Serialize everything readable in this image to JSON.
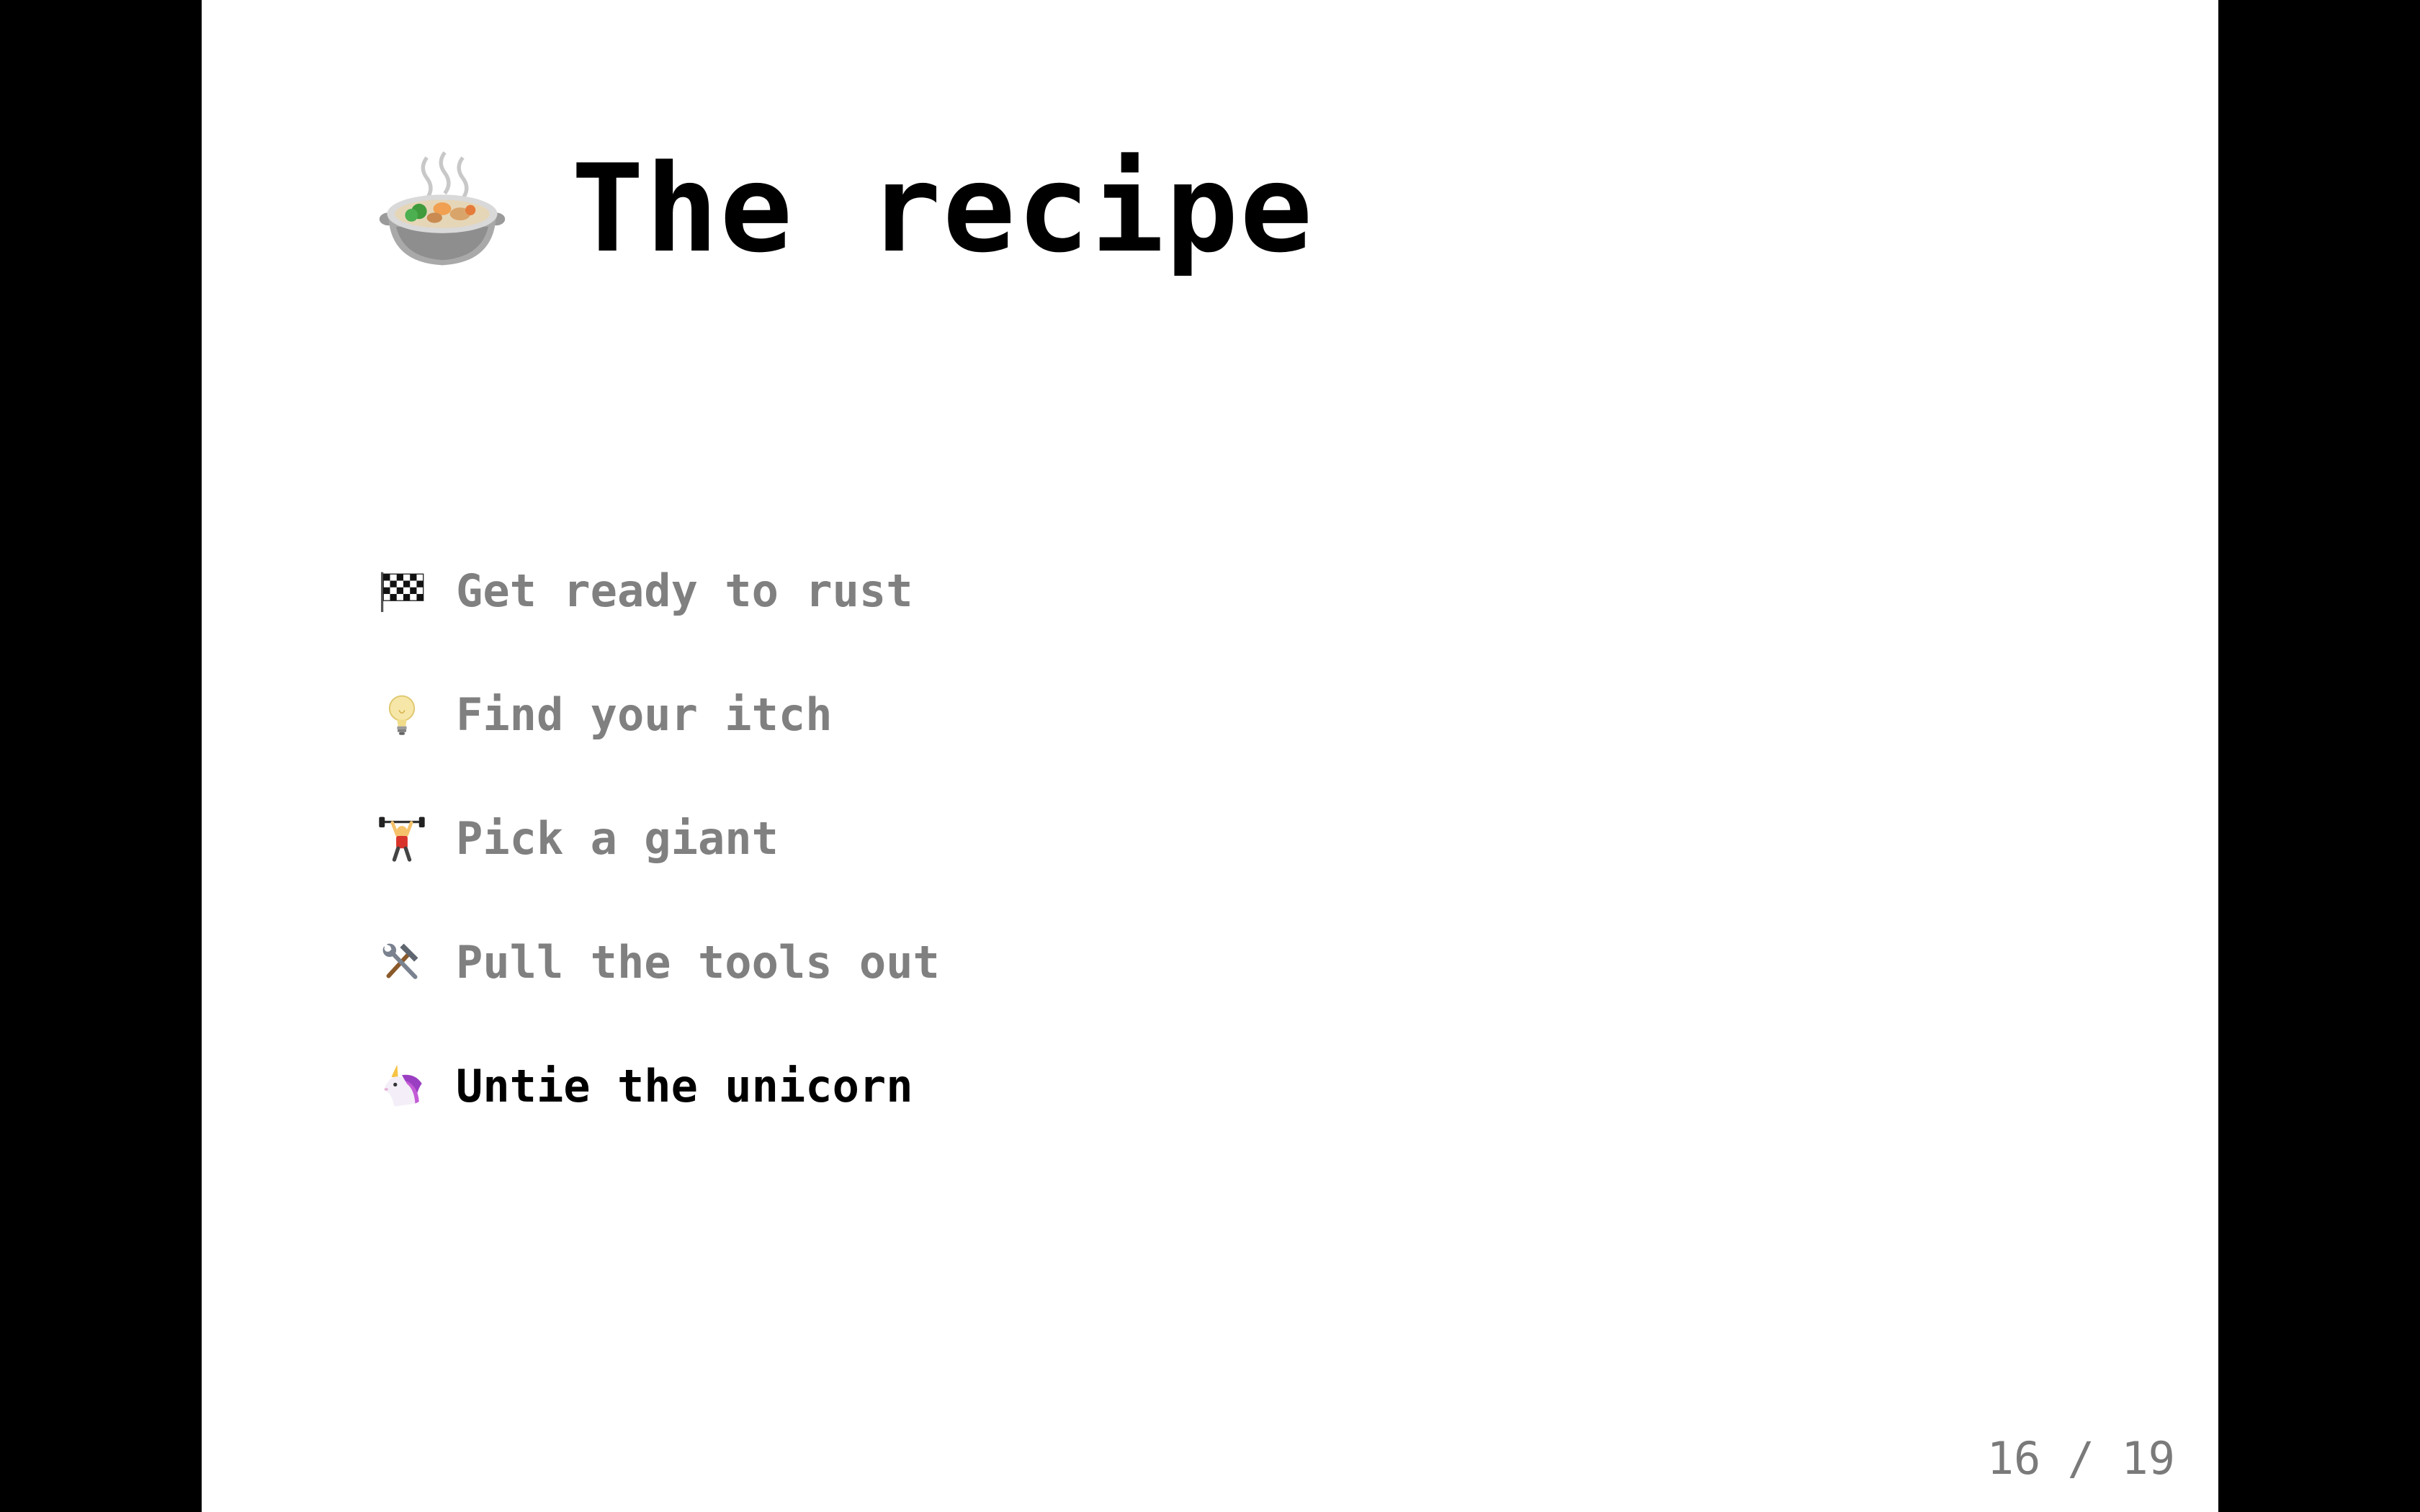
{
  "slide": {
    "title": "The recipe",
    "title_icon": "stew-pot-icon",
    "items": [
      {
        "label": "Get ready to rust",
        "icon": "checkered-flag-icon",
        "current": false
      },
      {
        "label": "Find your itch",
        "icon": "light-bulb-icon",
        "current": false
      },
      {
        "label": "Pick a giant",
        "icon": "weightlifter-icon",
        "current": false
      },
      {
        "label": "Pull the tools out",
        "icon": "hammer-and-wrench-icon",
        "current": false
      },
      {
        "label": "Untie the unicorn",
        "icon": "unicorn-icon",
        "current": true
      }
    ]
  },
  "pager": {
    "text": "16 / 19",
    "current": 16,
    "total": 19
  },
  "colors": {
    "background": "#000000",
    "slide": "#ffffff",
    "item_inactive": "#808080",
    "item_active": "#000000",
    "pager": "#7a7a7a"
  }
}
